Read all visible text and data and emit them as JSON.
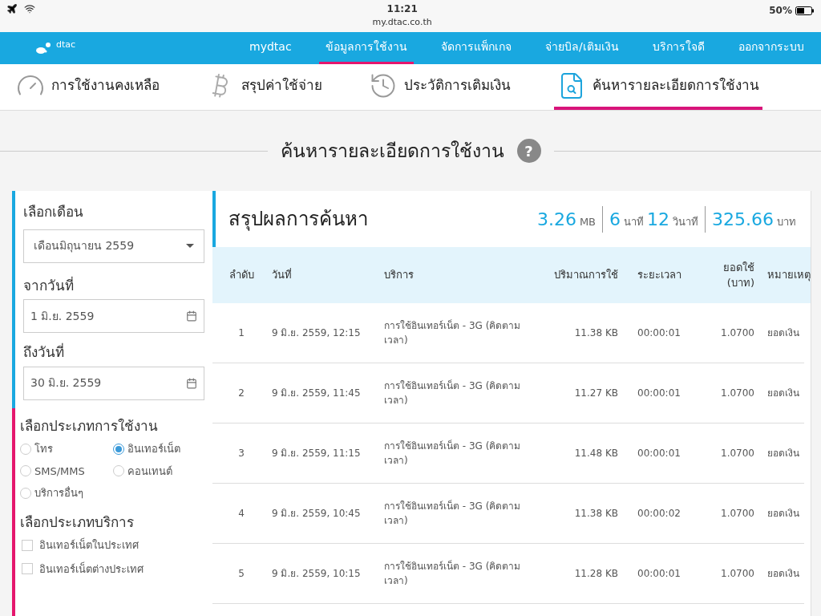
{
  "status_bar": {
    "time": "11:21",
    "url": "my.dtac.co.th",
    "battery": "50%"
  },
  "nav": {
    "logo": "dtac",
    "items": [
      {
        "label": "mydtac",
        "selected": false
      },
      {
        "label": "ข้อมูลการใช้งาน",
        "selected": true
      },
      {
        "label": "จัดการแพ็กเกจ",
        "selected": false
      },
      {
        "label": "จ่ายบิล/เติมเงิน",
        "selected": false
      },
      {
        "label": "บริการใจดี",
        "selected": false
      },
      {
        "label": "ออกจากระบบ",
        "selected": false
      }
    ]
  },
  "tabs": [
    {
      "label": "การใช้งานคงเหลือ",
      "kind": "gauge",
      "selected": false
    },
    {
      "label": "สรุปค่าใช้จ่าย",
      "kind": "coin",
      "selected": false
    },
    {
      "label": "ประวัติการเติมเงิน",
      "kind": "history",
      "selected": false
    },
    {
      "label": "ค้นหารายละเอียดการใช้งาน",
      "kind": "search",
      "selected": true
    }
  ],
  "page_title": "ค้นหารายละเอียดการใช้งาน",
  "help": "?",
  "filters": {
    "month_label": "เลือกเดือน",
    "month_value": "เดือนมิถุนายน 2559",
    "from_label": "จากวันที่",
    "from_value": "1 มิ.ย. 2559",
    "to_label": "ถึงวันที่",
    "to_value": "30 มิ.ย. 2559",
    "usage_type_label": "เลือกประเภทการใช้งาน",
    "usage_types": [
      {
        "label": "โทร",
        "selected": false
      },
      {
        "label": "อินเทอร์เน็ต",
        "selected": true
      },
      {
        "label": "SMS/MMS",
        "selected": false
      },
      {
        "label": "คอนเทนต์",
        "selected": false
      },
      {
        "label": "บริการอื่นๆ",
        "selected": false
      }
    ],
    "service_type_label": "เลือกประเภทบริการ",
    "service_types": [
      {
        "label": "อินเทอร์เน็ตในประเทศ",
        "checked": false
      },
      {
        "label": "อินเทอร์เน็ตต่างประเทศ",
        "checked": false
      }
    ]
  },
  "summary": {
    "title": "สรุปผลการค้นหา",
    "stats": [
      [
        {
          "value": "3.26",
          "unit": "MB"
        }
      ],
      [
        {
          "value": "6",
          "unit": "นาที"
        },
        {
          "value": "12",
          "unit": "วินาที"
        }
      ],
      [
        {
          "value": "325.66",
          "unit": "บาท"
        }
      ]
    ]
  },
  "table": {
    "columns": [
      "ลำดับ",
      "วันที่",
      "บริการ",
      "ปริมาณการใช้",
      "ระยะเวลา",
      "ยอดใช้ (บาท)",
      "หมายเหตุ"
    ],
    "rows": [
      [
        "1",
        "9 มิ.ย. 2559, 12:15",
        "การใช้อินเทอร์เน็ต - 3G (คิดตามเวลา)",
        "11.38 KB",
        "00:00:01",
        "1.0700",
        "ยอดเงิน"
      ],
      [
        "2",
        "9 มิ.ย. 2559, 11:45",
        "การใช้อินเทอร์เน็ต - 3G (คิดตามเวลา)",
        "11.27 KB",
        "00:00:01",
        "1.0700",
        "ยอดเงิน"
      ],
      [
        "3",
        "9 มิ.ย. 2559, 11:15",
        "การใช้อินเทอร์เน็ต - 3G (คิดตามเวลา)",
        "11.48 KB",
        "00:00:01",
        "1.0700",
        "ยอดเงิน"
      ],
      [
        "4",
        "9 มิ.ย. 2559, 10:45",
        "การใช้อินเทอร์เน็ต - 3G (คิดตามเวลา)",
        "11.38 KB",
        "00:00:02",
        "1.0700",
        "ยอดเงิน"
      ],
      [
        "5",
        "9 มิ.ย. 2559, 10:15",
        "การใช้อินเทอร์เน็ต - 3G (คิดตามเวลา)",
        "11.28 KB",
        "00:00:01",
        "1.0700",
        "ยอดเงิน"
      ]
    ]
  }
}
